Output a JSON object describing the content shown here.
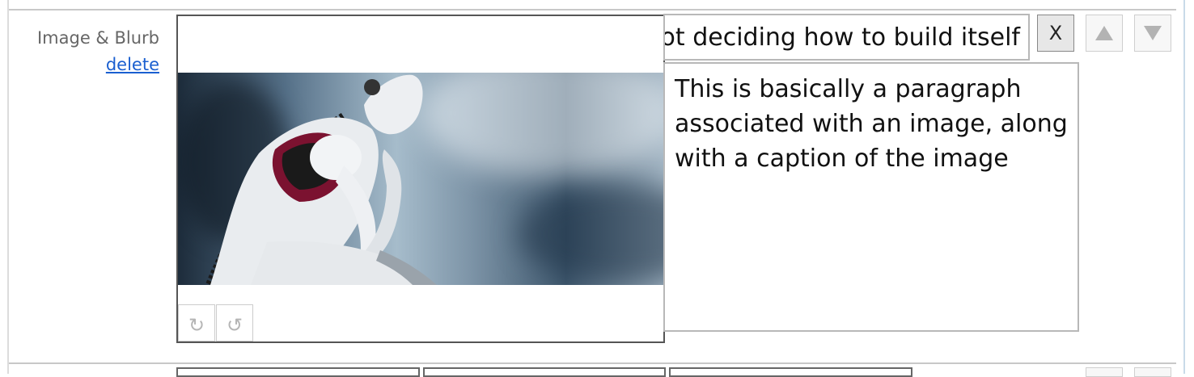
{
  "row": {
    "label": "Image & Blurb",
    "delete_label": "delete"
  },
  "image_editor": {
    "image": "robot-thinker-photo",
    "rotate_cw_icon": "↻",
    "rotate_ccw_icon": "↺"
  },
  "caption_input": {
    "value": "pot deciding how to build itself"
  },
  "blurb_textarea": {
    "value": "This is basically a paragraph associated with an image, along with a caption of the image"
  },
  "controls": {
    "remove_label": "X",
    "move_up_icon": "triangle-up-icon",
    "move_down_icon": "triangle-down-icon"
  },
  "colors": {
    "link": "#1a5fd0",
    "panel_border": "#555555",
    "field_border": "#b8b8b8",
    "muted_icon": "#b5b5b5"
  }
}
